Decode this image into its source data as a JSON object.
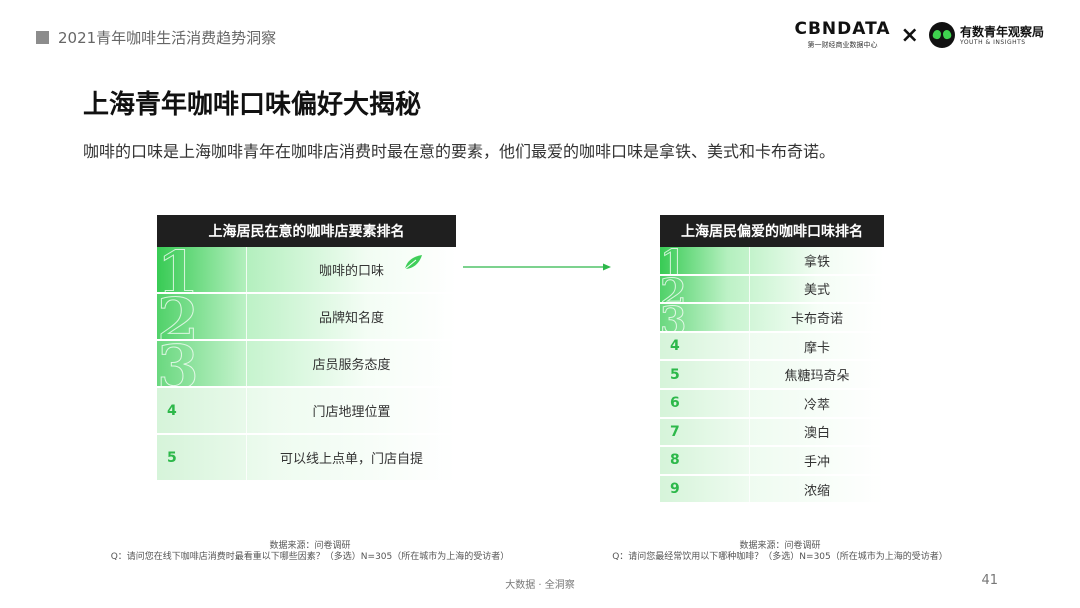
{
  "header": {
    "report_title": "2021青年咖啡生活消费趋势洞察"
  },
  "logos": {
    "cbndata_main": "CBNDATA",
    "cbndata_sub": "第一财经商业数据中心",
    "separator": "×",
    "partner_main": "有数青年观察局",
    "partner_sub": "YOUTH & INSIGHTS"
  },
  "title": "上海青年咖啡口味偏好大揭秘",
  "subtitle": "咖啡的口味是上海咖啡青年在咖啡店消费时最在意的要素，他们最爱的咖啡口味是拿铁、美式和卡布奇诺。",
  "table_factors": {
    "heading": "上海居民在意的咖啡店要素排名",
    "rows": [
      {
        "rank": "1",
        "label": "咖啡的口味"
      },
      {
        "rank": "2",
        "label": "品牌知名度"
      },
      {
        "rank": "3",
        "label": "店员服务态度"
      },
      {
        "rank": "4",
        "label": "门店地理位置"
      },
      {
        "rank": "5",
        "label": "可以线上点单，门店自提"
      }
    ]
  },
  "table_flavors": {
    "heading": "上海居民偏爱的咖啡口味排名",
    "rows": [
      {
        "rank": "1",
        "label": "拿铁"
      },
      {
        "rank": "2",
        "label": "美式"
      },
      {
        "rank": "3",
        "label": "卡布奇诺"
      },
      {
        "rank": "4",
        "label": "摩卡"
      },
      {
        "rank": "5",
        "label": "焦糖玛奇朵"
      },
      {
        "rank": "6",
        "label": "冷萃"
      },
      {
        "rank": "7",
        "label": "澳白"
      },
      {
        "rank": "8",
        "label": "手冲"
      },
      {
        "rank": "9",
        "label": "浓缩"
      }
    ]
  },
  "notes": {
    "left": {
      "source": "数据来源：问卷调研",
      "question": "Q：请问您在线下咖啡店消费时最看重以下哪些因素？（多选）N=305（所在城市为上海的受访者）"
    },
    "right": {
      "source": "数据来源：问卷调研",
      "question": "Q：请问您最经常饮用以下哪种咖啡？（多选）N=305（所在城市为上海的受访者）"
    }
  },
  "footer": {
    "tagline": "大数据 · 全洞察",
    "page_number": "41"
  },
  "colors": {
    "accent_green": "#2db84a",
    "head_bg": "#1f1f1f"
  },
  "icons": {
    "arrow": "arrow-right-icon",
    "leaf": "leaf-icon"
  }
}
